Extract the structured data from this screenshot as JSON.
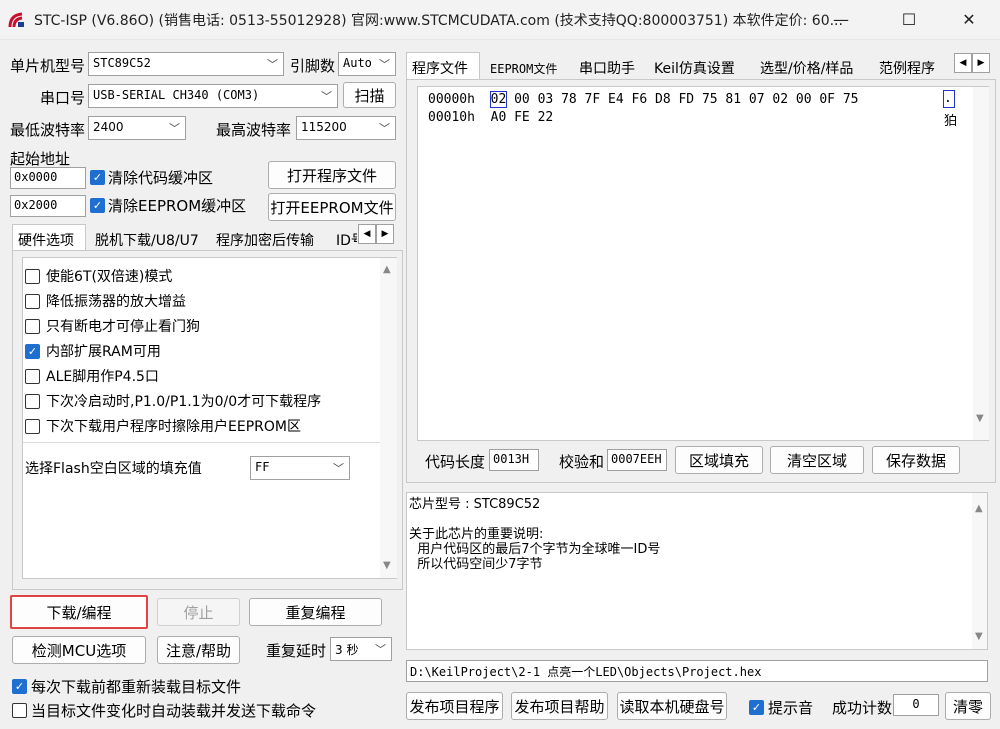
{
  "window": {
    "title": "STC-ISP (V6.86O) (销售电话: 0513-55012928) 官网:www.STCMCUDATA.com  (技术支持QQ:800003751) 本软件定价: 60...",
    "minimize": "—",
    "maximize": "☐",
    "close": "✕"
  },
  "left": {
    "mcu_label": "单片机型号",
    "mcu_value": "STC89C52",
    "pins_label": "引脚数",
    "pins_value": "Auto",
    "port_label": "串口号",
    "port_value": "USB-SERIAL CH340 (COM3)",
    "scan_button": "扫描",
    "min_baud_label": "最低波特率",
    "min_baud_value": "2400",
    "max_baud_label": "最高波特率",
    "max_baud_value": "115200",
    "start_addr_label": "起始地址",
    "addr1": "0x0000",
    "clear_code_label": "清除代码缓冲区",
    "open_prog_button": "打开程序文件",
    "addr2": "0x2000",
    "clear_eeprom_label": "清除EEPROM缓冲区",
    "open_eeprom_button": "打开EEPROM文件",
    "tabs": [
      "硬件选项",
      "脱机下载/U8/U7",
      "程序加密后传输",
      "ID号"
    ],
    "options": [
      {
        "label": "使能6T(双倍速)模式",
        "checked": false
      },
      {
        "label": "降低振荡器的放大增益",
        "checked": false
      },
      {
        "label": "只有断电才可停止看门狗",
        "checked": false
      },
      {
        "label": "内部扩展RAM可用",
        "checked": true
      },
      {
        "label": "ALE脚用作P4.5口",
        "checked": false
      },
      {
        "label": "下次冷启动时,P1.0/P1.1为0/0才可下载程序",
        "checked": false
      },
      {
        "label": "下次下载用户程序时擦除用户EEPROM区",
        "checked": false
      }
    ],
    "flash_fill_label": "选择Flash空白区域的填充值",
    "flash_fill_value": "FF",
    "download_button": "下载/编程",
    "stop_button": "停止",
    "reprogram_button": "重复编程",
    "check_mcu_button": "检测MCU选项",
    "help_button": "注意/帮助",
    "repeat_delay_label": "重复延时",
    "repeat_delay_value": "3 秒",
    "reload_before_download": "每次下载前都重新装载目标文件",
    "auto_reload": "当目标文件变化时自动装载并发送下载命令"
  },
  "right": {
    "tabs": [
      "程序文件",
      "EEPROM文件",
      "串口助手",
      "Keil仿真设置",
      "选型/价格/样品",
      "范例程序"
    ],
    "hex_lines": [
      {
        "addr": "00000h",
        "first": "02",
        "rest": "00 03 78 7F E4 F6 D8 FD 75 81 07 02 00 0F 75",
        "ascii": ".."
      },
      {
        "addr": "00010h",
        "first": "",
        "rest": "A0 FE 22",
        "ascii": "狛"
      }
    ],
    "code_len_label": "代码长度",
    "code_len_value": "0013H",
    "checksum_label": "校验和",
    "checksum_value": "0007EEH",
    "fill_button": "区域填充",
    "clear_button": "清空区域",
    "save_button": "保存数据",
    "chip_info": "芯片型号 : STC89C52\n\n关于此芯片的重要说明:\n  用户代码区的最后7个字节为全球唯一ID号\n  所以代码空间少7字节",
    "file_path": "D:\\KeilProject\\2-1 点亮一个LED\\Objects\\Project.hex",
    "publish_prog_button": "发布项目程序",
    "publish_help_button": "发布项目帮助",
    "read_disk_button": "读取本机硬盘号",
    "beep_label": "提示音",
    "success_label": "成功计数",
    "success_value": "0",
    "clear_count_button": "清零"
  }
}
